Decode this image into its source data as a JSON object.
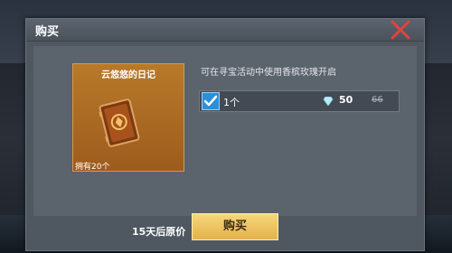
{
  "dialog": {
    "title": "购买",
    "close_icon": "close-x-icon"
  },
  "item": {
    "name": "云悠悠的日记",
    "owned": "拥有20个",
    "icon": "book-icon"
  },
  "description": "可在寻宝活动中使用香槟玫瑰开启",
  "option": {
    "checked": true,
    "quantity": "1个",
    "currency_icon": "diamond-icon",
    "price": "50",
    "original_price": "66"
  },
  "footer": {
    "promo_text": "15天后原价",
    "buy_label": "购买"
  },
  "colors": {
    "accent_gold": "#e8b74f",
    "close_red": "#e3433a",
    "check_blue": "#2d8fd6"
  }
}
